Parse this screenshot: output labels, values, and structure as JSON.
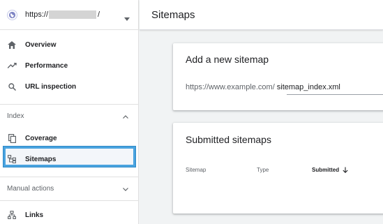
{
  "property": {
    "url_prefix": "https://",
    "url_suffix": "/",
    "icon": "globe-icon",
    "dropdown_icon": "caret-down-icon"
  },
  "nav": {
    "overview": {
      "label": "Overview",
      "icon": "home-icon"
    },
    "performance": {
      "label": "Performance",
      "icon": "trending-up-icon"
    },
    "url_inspection": {
      "label": "URL inspection",
      "icon": "search-icon"
    },
    "index_section": {
      "label": "Index",
      "icon": "chevron-up-icon"
    },
    "coverage": {
      "label": "Coverage",
      "icon": "copy-icon"
    },
    "sitemaps": {
      "label": "Sitemaps",
      "icon": "sitemap-icon"
    },
    "manual_actions_section": {
      "label": "Manual actions",
      "icon": "chevron-down-icon"
    },
    "links": {
      "label": "Links",
      "icon": "links-icon"
    }
  },
  "header": {
    "title": "Sitemaps"
  },
  "add_sitemap": {
    "title": "Add a new sitemap",
    "url_prefix": "https://www.example.com/",
    "input_value": "sitemap_index.xml"
  },
  "submitted": {
    "title": "Submitted sitemaps",
    "columns": {
      "sitemap": "Sitemap",
      "type": "Type",
      "submitted": "Submitted"
    },
    "sort_icon": "arrow-down-icon"
  },
  "colors": {
    "highlight": "#4aa3df",
    "background": "#f1f3f4"
  }
}
